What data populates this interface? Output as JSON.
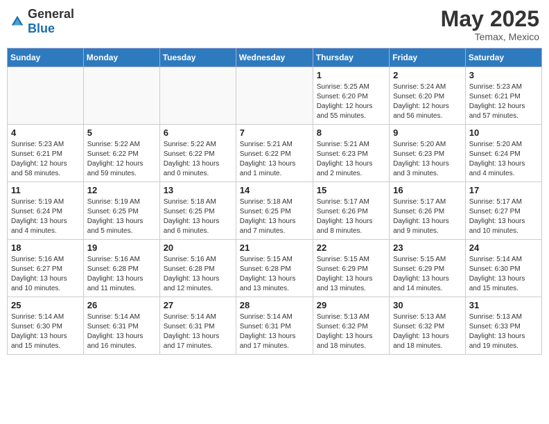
{
  "header": {
    "logo_general": "General",
    "logo_blue": "Blue",
    "month_title": "May 2025",
    "location": "Temax, Mexico"
  },
  "days_of_week": [
    "Sunday",
    "Monday",
    "Tuesday",
    "Wednesday",
    "Thursday",
    "Friday",
    "Saturday"
  ],
  "weeks": [
    [
      {
        "day": "",
        "info": ""
      },
      {
        "day": "",
        "info": ""
      },
      {
        "day": "",
        "info": ""
      },
      {
        "day": "",
        "info": ""
      },
      {
        "day": "1",
        "info": "Sunrise: 5:25 AM\nSunset: 6:20 PM\nDaylight: 12 hours\nand 55 minutes."
      },
      {
        "day": "2",
        "info": "Sunrise: 5:24 AM\nSunset: 6:20 PM\nDaylight: 12 hours\nand 56 minutes."
      },
      {
        "day": "3",
        "info": "Sunrise: 5:23 AM\nSunset: 6:21 PM\nDaylight: 12 hours\nand 57 minutes."
      }
    ],
    [
      {
        "day": "4",
        "info": "Sunrise: 5:23 AM\nSunset: 6:21 PM\nDaylight: 12 hours\nand 58 minutes."
      },
      {
        "day": "5",
        "info": "Sunrise: 5:22 AM\nSunset: 6:22 PM\nDaylight: 12 hours\nand 59 minutes."
      },
      {
        "day": "6",
        "info": "Sunrise: 5:22 AM\nSunset: 6:22 PM\nDaylight: 13 hours\nand 0 minutes."
      },
      {
        "day": "7",
        "info": "Sunrise: 5:21 AM\nSunset: 6:22 PM\nDaylight: 13 hours\nand 1 minute."
      },
      {
        "day": "8",
        "info": "Sunrise: 5:21 AM\nSunset: 6:23 PM\nDaylight: 13 hours\nand 2 minutes."
      },
      {
        "day": "9",
        "info": "Sunrise: 5:20 AM\nSunset: 6:23 PM\nDaylight: 13 hours\nand 3 minutes."
      },
      {
        "day": "10",
        "info": "Sunrise: 5:20 AM\nSunset: 6:24 PM\nDaylight: 13 hours\nand 4 minutes."
      }
    ],
    [
      {
        "day": "11",
        "info": "Sunrise: 5:19 AM\nSunset: 6:24 PM\nDaylight: 13 hours\nand 4 minutes."
      },
      {
        "day": "12",
        "info": "Sunrise: 5:19 AM\nSunset: 6:25 PM\nDaylight: 13 hours\nand 5 minutes."
      },
      {
        "day": "13",
        "info": "Sunrise: 5:18 AM\nSunset: 6:25 PM\nDaylight: 13 hours\nand 6 minutes."
      },
      {
        "day": "14",
        "info": "Sunrise: 5:18 AM\nSunset: 6:25 PM\nDaylight: 13 hours\nand 7 minutes."
      },
      {
        "day": "15",
        "info": "Sunrise: 5:17 AM\nSunset: 6:26 PM\nDaylight: 13 hours\nand 8 minutes."
      },
      {
        "day": "16",
        "info": "Sunrise: 5:17 AM\nSunset: 6:26 PM\nDaylight: 13 hours\nand 9 minutes."
      },
      {
        "day": "17",
        "info": "Sunrise: 5:17 AM\nSunset: 6:27 PM\nDaylight: 13 hours\nand 10 minutes."
      }
    ],
    [
      {
        "day": "18",
        "info": "Sunrise: 5:16 AM\nSunset: 6:27 PM\nDaylight: 13 hours\nand 10 minutes."
      },
      {
        "day": "19",
        "info": "Sunrise: 5:16 AM\nSunset: 6:28 PM\nDaylight: 13 hours\nand 11 minutes."
      },
      {
        "day": "20",
        "info": "Sunrise: 5:16 AM\nSunset: 6:28 PM\nDaylight: 13 hours\nand 12 minutes."
      },
      {
        "day": "21",
        "info": "Sunrise: 5:15 AM\nSunset: 6:28 PM\nDaylight: 13 hours\nand 13 minutes."
      },
      {
        "day": "22",
        "info": "Sunrise: 5:15 AM\nSunset: 6:29 PM\nDaylight: 13 hours\nand 13 minutes."
      },
      {
        "day": "23",
        "info": "Sunrise: 5:15 AM\nSunset: 6:29 PM\nDaylight: 13 hours\nand 14 minutes."
      },
      {
        "day": "24",
        "info": "Sunrise: 5:14 AM\nSunset: 6:30 PM\nDaylight: 13 hours\nand 15 minutes."
      }
    ],
    [
      {
        "day": "25",
        "info": "Sunrise: 5:14 AM\nSunset: 6:30 PM\nDaylight: 13 hours\nand 15 minutes."
      },
      {
        "day": "26",
        "info": "Sunrise: 5:14 AM\nSunset: 6:31 PM\nDaylight: 13 hours\nand 16 minutes."
      },
      {
        "day": "27",
        "info": "Sunrise: 5:14 AM\nSunset: 6:31 PM\nDaylight: 13 hours\nand 17 minutes."
      },
      {
        "day": "28",
        "info": "Sunrise: 5:14 AM\nSunset: 6:31 PM\nDaylight: 13 hours\nand 17 minutes."
      },
      {
        "day": "29",
        "info": "Sunrise: 5:13 AM\nSunset: 6:32 PM\nDaylight: 13 hours\nand 18 minutes."
      },
      {
        "day": "30",
        "info": "Sunrise: 5:13 AM\nSunset: 6:32 PM\nDaylight: 13 hours\nand 18 minutes."
      },
      {
        "day": "31",
        "info": "Sunrise: 5:13 AM\nSunset: 6:33 PM\nDaylight: 13 hours\nand 19 minutes."
      }
    ]
  ]
}
